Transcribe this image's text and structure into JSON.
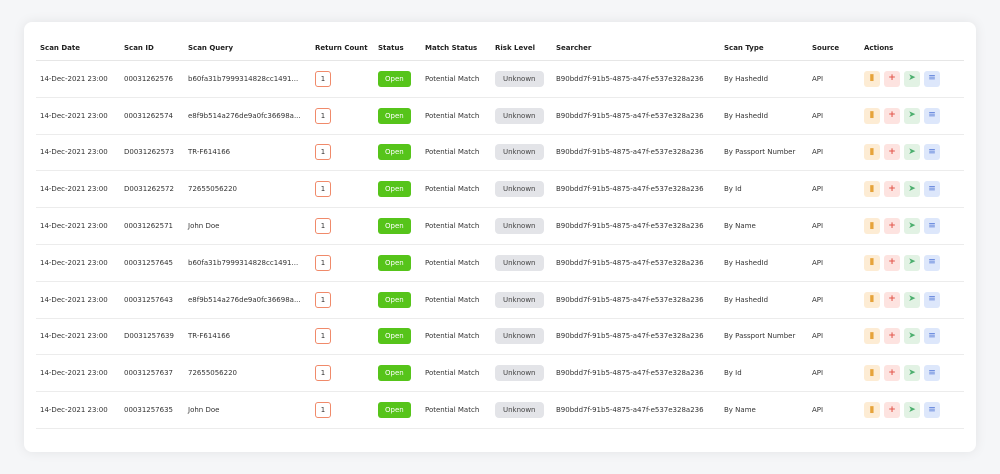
{
  "columns": {
    "scan_date": "Scan Date",
    "scan_id": "Scan ID",
    "scan_query": "Scan Query",
    "return_count": "Return Count",
    "status": "Status",
    "match_status": "Match Status",
    "risk_level": "Risk Level",
    "searcher": "Searcher",
    "scan_type": "Scan Type",
    "source": "Source",
    "actions": "Actions"
  },
  "action_icons": [
    "document-icon",
    "add-icon",
    "send-icon",
    "file-icon"
  ],
  "colors": {
    "status_open": "#56c41a",
    "count_border": "#f08a6a",
    "risk_bg": "#e3e4e8",
    "doc_icon": "#e6a33a",
    "add_icon": "#e2574c",
    "send_icon": "#4caf6e",
    "file_icon": "#4d74d6"
  },
  "rows": [
    {
      "scan_date": "14-Dec-2021 23:00",
      "scan_id": "00031262576",
      "scan_query": "b60fa31b7999314828cc1491...",
      "return_count": "1",
      "status": "Open",
      "match_status": "Potential Match",
      "risk_level": "Unknown",
      "searcher": "B90bdd7f-91b5-4875-a47f-e537e328a236",
      "scan_type": "By HashedId",
      "source": "API"
    },
    {
      "scan_date": "14-Dec-2021 23:00",
      "scan_id": "00031262574",
      "scan_query": "e8f9b514a276de9a0fc3669​8a...",
      "return_count": "1",
      "status": "Open",
      "match_status": "Potential Match",
      "risk_level": "Unknown",
      "searcher": "B90bdd7f-91b5-4875-a47f-e537e328a236",
      "scan_type": "By HashedId",
      "source": "API"
    },
    {
      "scan_date": "14-Dec-2021 23:00",
      "scan_id": "D0031262573",
      "scan_query": "TR-F614166",
      "return_count": "1",
      "status": "Open",
      "match_status": "Potential Match",
      "risk_level": "Unknown",
      "searcher": "B90bdd7f-91b5-4875-a47f-e537e328a236",
      "scan_type": "By Passport Number",
      "source": "API"
    },
    {
      "scan_date": "14-Dec-2021 23:00",
      "scan_id": "D0031262572",
      "scan_query": "72655056220",
      "return_count": "1",
      "status": "Open",
      "match_status": "Potential Match",
      "risk_level": "Unknown",
      "searcher": "B90bdd7f-91b5-4875-a47f-e537e328a236",
      "scan_type": "By Id",
      "source": "API"
    },
    {
      "scan_date": "14-Dec-2021 23:00",
      "scan_id": "00031262571",
      "scan_query": "John Doe",
      "return_count": "1",
      "status": "Open",
      "match_status": "Potential Match",
      "risk_level": "Unknown",
      "searcher": "B90bdd7f-91b5-4875-a47f-e537e328a236",
      "scan_type": "By Name",
      "source": "API"
    },
    {
      "scan_date": "14-Dec-2021 23:00",
      "scan_id": "00031257645",
      "scan_query": "b60fa31b7999314828cc1491...",
      "return_count": "1",
      "status": "Open",
      "match_status": "Potential Match",
      "risk_level": "Unknown",
      "searcher": "B90bdd7f-91b5-4875-a47f-e537e328a236",
      "scan_type": "By HashedId",
      "source": "API"
    },
    {
      "scan_date": "14-Dec-2021 23:00",
      "scan_id": "00031257643",
      "scan_query": "e8f9b514a276de9a0fc36698a...",
      "return_count": "1",
      "status": "Open",
      "match_status": "Potential Match",
      "risk_level": "Unknown",
      "searcher": "B90bdd7f-91b5-4875-a47f-e537e328a236",
      "scan_type": "By HashedId",
      "source": "API"
    },
    {
      "scan_date": "14-Dec-2021 23:00",
      "scan_id": "D0031257639",
      "scan_query": "TR-F614166",
      "return_count": "1",
      "status": "Open",
      "match_status": "Potential Match",
      "risk_level": "Unknown",
      "searcher": "B90bdd7f-91b5-4875-a47f-e537e328a236",
      "scan_type": "By Passport Number",
      "source": "API"
    },
    {
      "scan_date": "14-Dec-2021 23:00",
      "scan_id": "00031257637",
      "scan_query": "72655056220",
      "return_count": "1",
      "status": "Open",
      "match_status": "Potential Match",
      "risk_level": "Unknown",
      "searcher": "B90bdd7f-91b5-4875-a47f-e537e328a236",
      "scan_type": "By Id",
      "source": "API"
    },
    {
      "scan_date": "14-Dec-2021 23:00",
      "scan_id": "00031257635",
      "scan_query": "John Doe",
      "return_count": "1",
      "status": "Open",
      "match_status": "Potential Match",
      "risk_level": "Unknown",
      "searcher": "B90bdd7f-91b5-4875-a47f-e537e328a236",
      "scan_type": "By Name",
      "source": "API"
    }
  ]
}
